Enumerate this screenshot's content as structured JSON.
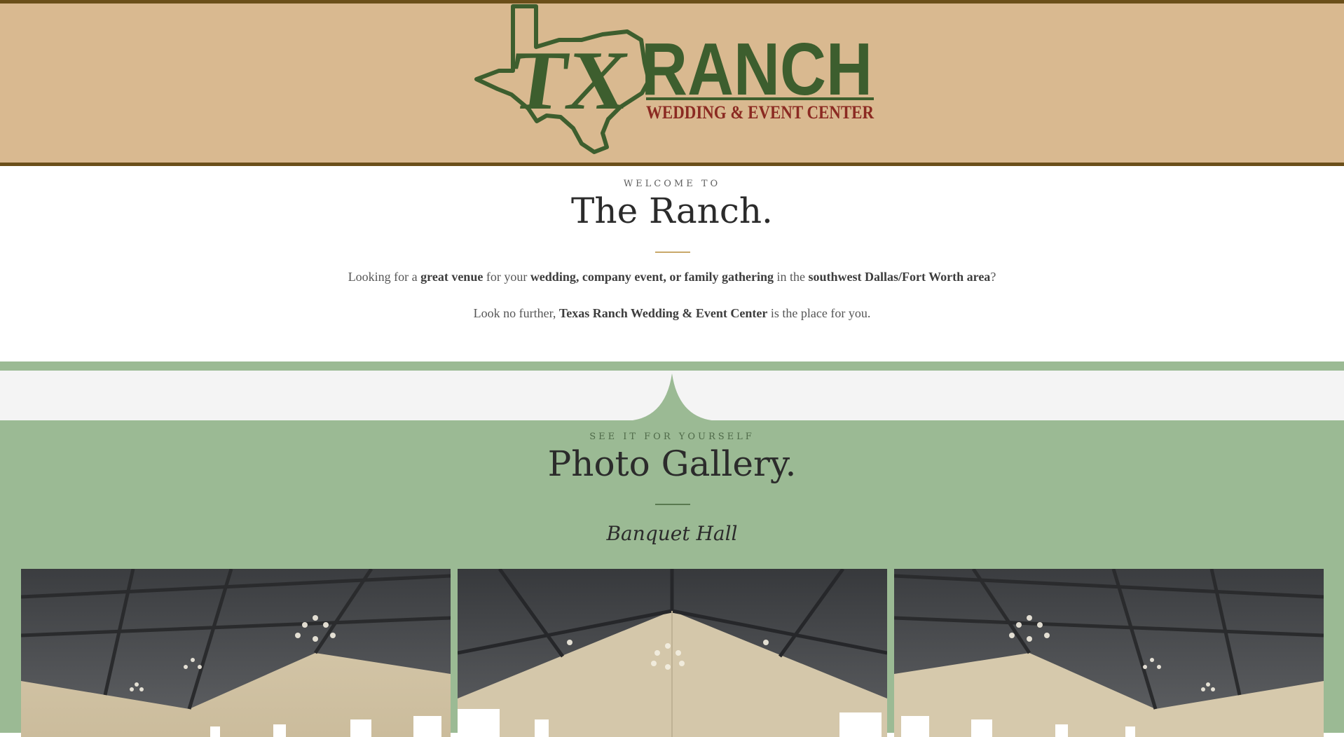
{
  "header": {
    "logo": {
      "mark_text": "TX",
      "name_text": "RANCH",
      "tagline_text": "WEDDING & EVENT CENTER",
      "green": "#3d5e2e",
      "red": "#8b2a22"
    },
    "background": "#d9b990",
    "border_color": "#6b4f1a"
  },
  "welcome": {
    "kicker": "WELCOME TO",
    "title": "The Ranch.",
    "divider_color": "#c9a86a",
    "line1": {
      "t1": "Looking for a ",
      "b1": "great venue",
      "t2": " for your ",
      "b2": "wedding, company event, or family gathering",
      "t3": " in the ",
      "b3": "southwest Dallas/Fort Worth area",
      "t4": "?"
    },
    "line2": {
      "t1": "Look no further, ",
      "b1": "Texas Ranch Wedding & Event Center",
      "t2": " is the place for you."
    }
  },
  "gallery": {
    "kicker": "SEE IT FOR YOURSELF",
    "title": "Photo Gallery.",
    "divider_color": "#5a7a50",
    "section_label": "Banquet Hall",
    "background": "#9bba94",
    "photos": [
      {
        "subject": "banquet-hall-photo-1"
      },
      {
        "subject": "banquet-hall-photo-2"
      },
      {
        "subject": "banquet-hall-photo-3"
      }
    ]
  }
}
